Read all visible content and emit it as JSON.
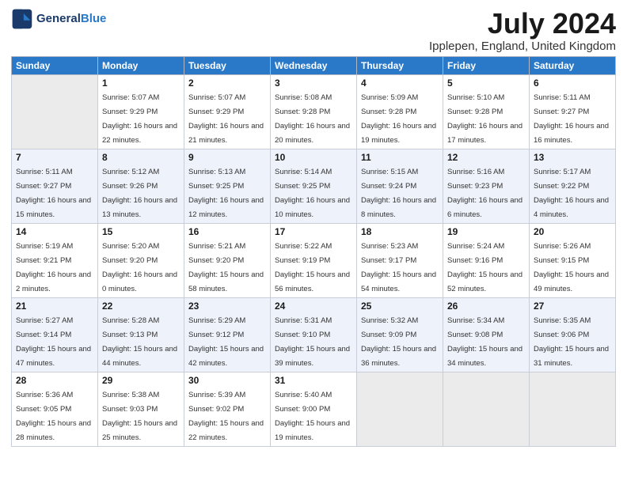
{
  "header": {
    "logo_line1": "General",
    "logo_line2": "Blue",
    "month": "July 2024",
    "location": "Ipplepen, England, United Kingdom"
  },
  "weekdays": [
    "Sunday",
    "Monday",
    "Tuesday",
    "Wednesday",
    "Thursday",
    "Friday",
    "Saturday"
  ],
  "weeks": [
    [
      {
        "day": "",
        "empty": true
      },
      {
        "day": "1",
        "sunrise": "Sunrise: 5:07 AM",
        "sunset": "Sunset: 9:29 PM",
        "daylight": "Daylight: 16 hours and 22 minutes."
      },
      {
        "day": "2",
        "sunrise": "Sunrise: 5:07 AM",
        "sunset": "Sunset: 9:29 PM",
        "daylight": "Daylight: 16 hours and 21 minutes."
      },
      {
        "day": "3",
        "sunrise": "Sunrise: 5:08 AM",
        "sunset": "Sunset: 9:28 PM",
        "daylight": "Daylight: 16 hours and 20 minutes."
      },
      {
        "day": "4",
        "sunrise": "Sunrise: 5:09 AM",
        "sunset": "Sunset: 9:28 PM",
        "daylight": "Daylight: 16 hours and 19 minutes."
      },
      {
        "day": "5",
        "sunrise": "Sunrise: 5:10 AM",
        "sunset": "Sunset: 9:28 PM",
        "daylight": "Daylight: 16 hours and 17 minutes."
      },
      {
        "day": "6",
        "sunrise": "Sunrise: 5:11 AM",
        "sunset": "Sunset: 9:27 PM",
        "daylight": "Daylight: 16 hours and 16 minutes."
      }
    ],
    [
      {
        "day": "7",
        "sunrise": "Sunrise: 5:11 AM",
        "sunset": "Sunset: 9:27 PM",
        "daylight": "Daylight: 16 hours and 15 minutes."
      },
      {
        "day": "8",
        "sunrise": "Sunrise: 5:12 AM",
        "sunset": "Sunset: 9:26 PM",
        "daylight": "Daylight: 16 hours and 13 minutes."
      },
      {
        "day": "9",
        "sunrise": "Sunrise: 5:13 AM",
        "sunset": "Sunset: 9:25 PM",
        "daylight": "Daylight: 16 hours and 12 minutes."
      },
      {
        "day": "10",
        "sunrise": "Sunrise: 5:14 AM",
        "sunset": "Sunset: 9:25 PM",
        "daylight": "Daylight: 16 hours and 10 minutes."
      },
      {
        "day": "11",
        "sunrise": "Sunrise: 5:15 AM",
        "sunset": "Sunset: 9:24 PM",
        "daylight": "Daylight: 16 hours and 8 minutes."
      },
      {
        "day": "12",
        "sunrise": "Sunrise: 5:16 AM",
        "sunset": "Sunset: 9:23 PM",
        "daylight": "Daylight: 16 hours and 6 minutes."
      },
      {
        "day": "13",
        "sunrise": "Sunrise: 5:17 AM",
        "sunset": "Sunset: 9:22 PM",
        "daylight": "Daylight: 16 hours and 4 minutes."
      }
    ],
    [
      {
        "day": "14",
        "sunrise": "Sunrise: 5:19 AM",
        "sunset": "Sunset: 9:21 PM",
        "daylight": "Daylight: 16 hours and 2 minutes."
      },
      {
        "day": "15",
        "sunrise": "Sunrise: 5:20 AM",
        "sunset": "Sunset: 9:20 PM",
        "daylight": "Daylight: 16 hours and 0 minutes."
      },
      {
        "day": "16",
        "sunrise": "Sunrise: 5:21 AM",
        "sunset": "Sunset: 9:20 PM",
        "daylight": "Daylight: 15 hours and 58 minutes."
      },
      {
        "day": "17",
        "sunrise": "Sunrise: 5:22 AM",
        "sunset": "Sunset: 9:19 PM",
        "daylight": "Daylight: 15 hours and 56 minutes."
      },
      {
        "day": "18",
        "sunrise": "Sunrise: 5:23 AM",
        "sunset": "Sunset: 9:17 PM",
        "daylight": "Daylight: 15 hours and 54 minutes."
      },
      {
        "day": "19",
        "sunrise": "Sunrise: 5:24 AM",
        "sunset": "Sunset: 9:16 PM",
        "daylight": "Daylight: 15 hours and 52 minutes."
      },
      {
        "day": "20",
        "sunrise": "Sunrise: 5:26 AM",
        "sunset": "Sunset: 9:15 PM",
        "daylight": "Daylight: 15 hours and 49 minutes."
      }
    ],
    [
      {
        "day": "21",
        "sunrise": "Sunrise: 5:27 AM",
        "sunset": "Sunset: 9:14 PM",
        "daylight": "Daylight: 15 hours and 47 minutes."
      },
      {
        "day": "22",
        "sunrise": "Sunrise: 5:28 AM",
        "sunset": "Sunset: 9:13 PM",
        "daylight": "Daylight: 15 hours and 44 minutes."
      },
      {
        "day": "23",
        "sunrise": "Sunrise: 5:29 AM",
        "sunset": "Sunset: 9:12 PM",
        "daylight": "Daylight: 15 hours and 42 minutes."
      },
      {
        "day": "24",
        "sunrise": "Sunrise: 5:31 AM",
        "sunset": "Sunset: 9:10 PM",
        "daylight": "Daylight: 15 hours and 39 minutes."
      },
      {
        "day": "25",
        "sunrise": "Sunrise: 5:32 AM",
        "sunset": "Sunset: 9:09 PM",
        "daylight": "Daylight: 15 hours and 36 minutes."
      },
      {
        "day": "26",
        "sunrise": "Sunrise: 5:34 AM",
        "sunset": "Sunset: 9:08 PM",
        "daylight": "Daylight: 15 hours and 34 minutes."
      },
      {
        "day": "27",
        "sunrise": "Sunrise: 5:35 AM",
        "sunset": "Sunset: 9:06 PM",
        "daylight": "Daylight: 15 hours and 31 minutes."
      }
    ],
    [
      {
        "day": "28",
        "sunrise": "Sunrise: 5:36 AM",
        "sunset": "Sunset: 9:05 PM",
        "daylight": "Daylight: 15 hours and 28 minutes."
      },
      {
        "day": "29",
        "sunrise": "Sunrise: 5:38 AM",
        "sunset": "Sunset: 9:03 PM",
        "daylight": "Daylight: 15 hours and 25 minutes."
      },
      {
        "day": "30",
        "sunrise": "Sunrise: 5:39 AM",
        "sunset": "Sunset: 9:02 PM",
        "daylight": "Daylight: 15 hours and 22 minutes."
      },
      {
        "day": "31",
        "sunrise": "Sunrise: 5:40 AM",
        "sunset": "Sunset: 9:00 PM",
        "daylight": "Daylight: 15 hours and 19 minutes."
      },
      {
        "day": "",
        "empty": true
      },
      {
        "day": "",
        "empty": true
      },
      {
        "day": "",
        "empty": true
      }
    ]
  ]
}
